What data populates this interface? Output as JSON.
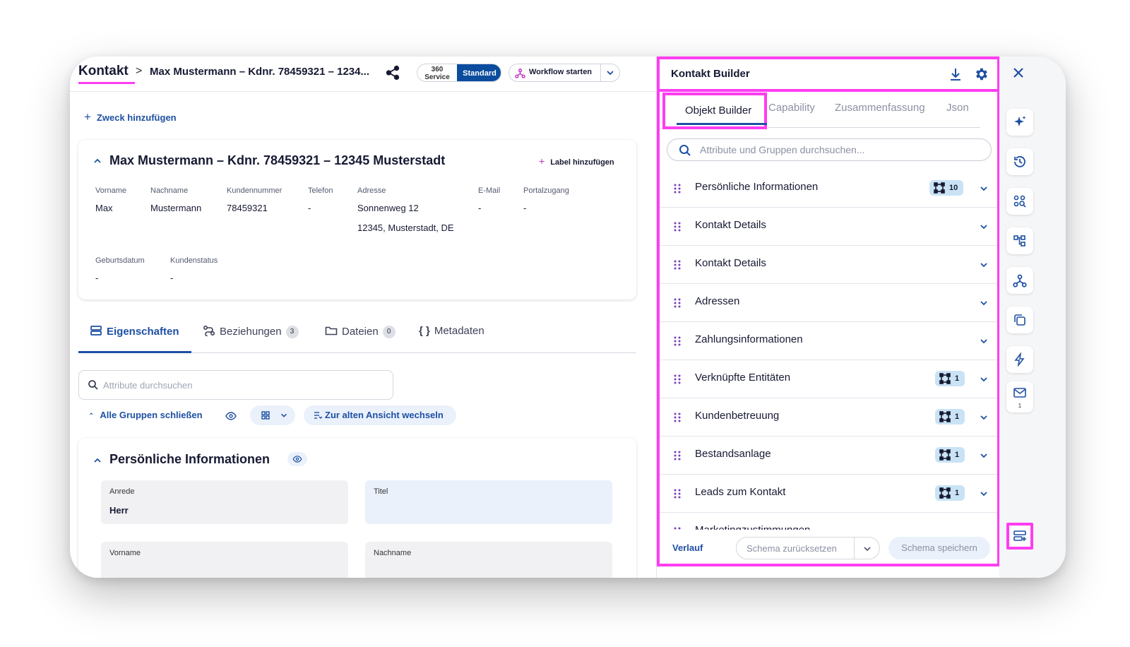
{
  "header": {
    "breadcrumb_root": "Kontakt",
    "breadcrumb_sep": ">",
    "record_title": "Max Mustermann – Kdnr. 78459321 – 1234...",
    "view_toggle": {
      "left_top": "360",
      "left_bottom": "Service",
      "right": "Standard"
    },
    "workflow_label": "Workflow starten"
  },
  "purpose_add": "Zweck hinzufügen",
  "contact_card": {
    "title": "Max Mustermann – Kdnr. 78459321 – 12345 Musterstadt",
    "label_add": "Label hinzufügen",
    "fields_row1": [
      {
        "label": "Vorname",
        "value": "Max"
      },
      {
        "label": "Nachname",
        "value": "Mustermann"
      },
      {
        "label": "Kundennummer",
        "value": "78459321"
      },
      {
        "label": "Telefon",
        "value": "-"
      },
      {
        "label": "Adresse",
        "value": "Sonnenweg 12"
      },
      {
        "label": "E-Mail",
        "value": "-"
      },
      {
        "label": "Portalzugang",
        "value": "-"
      }
    ],
    "address_line2": "12345, Musterstadt, DE",
    "fields_row2": [
      {
        "label": "Geburtsdatum",
        "value": "-"
      },
      {
        "label": "Kundenstatus",
        "value": "-"
      }
    ]
  },
  "tabs": [
    {
      "label": "Eigenschaften"
    },
    {
      "label": "Beziehungen",
      "badge": "3"
    },
    {
      "label": "Dateien",
      "badge": "0"
    },
    {
      "label": "Metadaten"
    }
  ],
  "attr_search_placeholder": "Attribute durchsuchen",
  "close_groups": "Alle Gruppen schließen",
  "old_view": "Zur alten Ansicht wechseln",
  "group": {
    "title": "Persönliche Informationen",
    "fields": [
      {
        "label": "Anrede",
        "value": "Herr"
      },
      {
        "label": "Titel",
        "value": ""
      },
      {
        "label": "Vorname",
        "value": ""
      },
      {
        "label": "Nachname",
        "value": ""
      }
    ]
  },
  "builder": {
    "title": "Kontakt Builder",
    "tabs": [
      "Objekt Builder",
      "Capability",
      "Zusammenfassung",
      "Json"
    ],
    "search_placeholder": "Attribute und Gruppen durchsuchen...",
    "items": [
      {
        "name": "Persönliche Informationen",
        "count": "10"
      },
      {
        "name": "Kontakt Details",
        "count": ""
      },
      {
        "name": "Kontakt Details",
        "count": ""
      },
      {
        "name": "Adressen",
        "count": ""
      },
      {
        "name": "Zahlungsinformationen",
        "count": ""
      },
      {
        "name": "Verknüpfte Entitäten",
        "count": "1"
      },
      {
        "name": "Kundenbetreuung",
        "count": "1"
      },
      {
        "name": "Bestandsanlage",
        "count": "1"
      },
      {
        "name": "Leads zum Kontakt",
        "count": "1"
      },
      {
        "name": "Marketingzustimmungen",
        "count": ""
      }
    ],
    "footer": {
      "history": "Verlauf",
      "reset": "Schema zurücksetzen",
      "save": "Schema speichern"
    }
  },
  "rail": {
    "mail_count": "1"
  },
  "colors": {
    "accent": "#1e4fa3",
    "highlight": "#ff3df0",
    "brand_dark": "#0b4c9e",
    "purple": "#c02fbf"
  }
}
